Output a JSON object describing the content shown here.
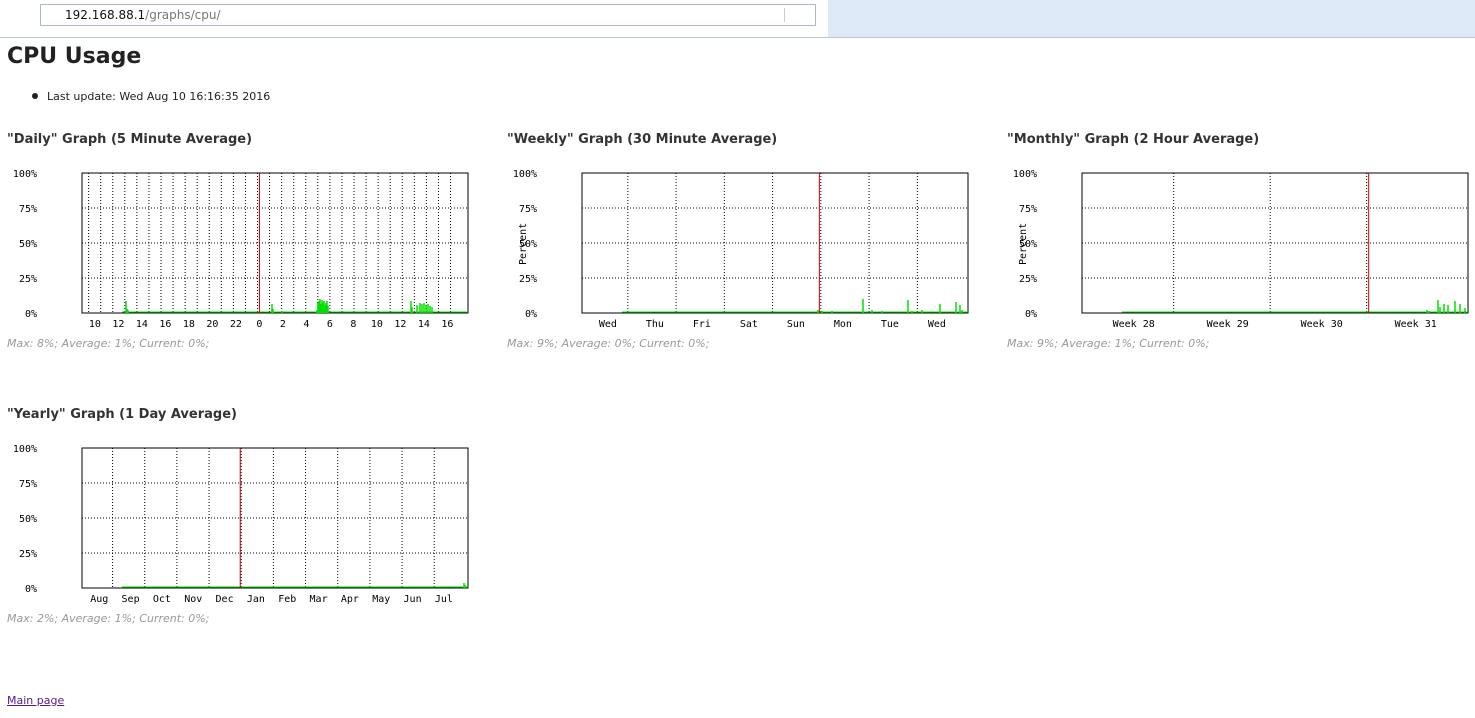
{
  "browser": {
    "url_host": "192.168.88.1",
    "url_path": "/graphs/cpu/"
  },
  "page": {
    "title": "CPU Usage",
    "last_update": "Last update: Wed Aug 10 16:16:35 2016",
    "main_link": "Main page"
  },
  "colors": {
    "data": "#00e000",
    "marker": "#c00000",
    "grid": "#000000"
  },
  "graphs": [
    {
      "title": "\"Daily\" Graph (5 Minute Average)",
      "stats": "Max: 8%; Average: 1%; Current: 0%;",
      "ylabel": "",
      "yticks": [
        "100%",
        "75%",
        "50%",
        "25%",
        "0%"
      ],
      "xticks": [
        "10",
        "12",
        "14",
        "16",
        "18",
        "20",
        "22",
        "0",
        "2",
        "4",
        "6",
        "8",
        "10",
        "12",
        "14",
        "16"
      ],
      "marker_label_index": 7
    },
    {
      "title": "\"Weekly\" Graph (30 Minute Average)",
      "stats": "Max: 9%; Average: 0%; Current: 0%;",
      "ylabel": "Percent",
      "yticks": [
        "100%",
        "75%",
        "50%",
        "25%",
        "0%"
      ],
      "xticks": [
        "Wed",
        "Thu",
        "Fri",
        "Sat",
        "Sun",
        "Mon",
        "Tue",
        "Wed"
      ],
      "marker_label_index": 4.5
    },
    {
      "title": "\"Monthly\" Graph (2 Hour Average)",
      "stats": "Max: 9%; Average: 1%; Current: 0%;",
      "ylabel": "Percent",
      "yticks": [
        "100%",
        "75%",
        "50%",
        "25%",
        "0%"
      ],
      "xticks": [
        "Week 28",
        "Week 29",
        "Week 30",
        "Week 31"
      ],
      "marker_label_index": 2.5
    },
    {
      "title": "\"Yearly\" Graph (1 Day Average)",
      "stats": "Max: 2%; Average: 1%; Current: 0%;",
      "ylabel": "",
      "yticks": [
        "100%",
        "75%",
        "50%",
        "25%",
        "0%"
      ],
      "xticks": [
        "Aug",
        "Sep",
        "Oct",
        "Nov",
        "Dec",
        "Jan",
        "Feb",
        "Mar",
        "Apr",
        "May",
        "Jun",
        "Jul"
      ],
      "marker_label_index": 4.5
    }
  ]
}
